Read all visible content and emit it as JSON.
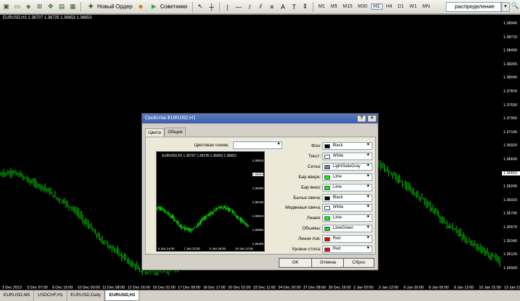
{
  "toolbar": {
    "new_order": "Новый Ордер",
    "advisors": "Советники",
    "timeframes": [
      "M1",
      "M5",
      "M15",
      "M30",
      "H1",
      "H4",
      "D1",
      "W1",
      "MN"
    ],
    "active_timeframe": "H1",
    "search_value": "распределение"
  },
  "chart": {
    "info": "EURUSD,H1  1.36707 1.36725 1.36653 1.36653",
    "price_labels": [
      "1.38940",
      "1.38715",
      "1.38490",
      "1.38265",
      "1.38040",
      "1.37815",
      "1.37590",
      "1.37365",
      "1.37145",
      "1.36920",
      "1.36695",
      "1.36653",
      "1.36245",
      "1.36020",
      "1.35795",
      "1.35570",
      "1.35345",
      "1.35125",
      "1.34900"
    ],
    "current_price": "1.36653",
    "time_labels": [
      "3 Dec 2013",
      "5 Dec 07:00",
      "6 Dec 15:00",
      "10 Dec 00:00",
      "11 Dec 08:00",
      "12 Dec 16:00",
      "16 Dec 01:00",
      "17 Dec 09:00",
      "18 Dec 17:00",
      "20 Dec 01:00",
      "23 Dec 11:00",
      "24 Dec 20:00",
      "27 Dec 08:00",
      "30 Dec 16:00",
      "2 Jan 02:00",
      "3 Jan 12:00",
      "6 Jan 20:00",
      "8 Jan 05:00",
      "9 Jan 13:00",
      "10 Jan 21:00",
      "13 Jan 19:00"
    ],
    "candle_color": "#00ff00",
    "background": "#000000"
  },
  "dialog": {
    "title": "Свойства EURUSD,H1",
    "help_btn": "?",
    "close_btn": "×",
    "tabs": [
      "Цвета",
      "Общие"
    ],
    "scheme_label": "Цветовая схема:",
    "scheme_value": "",
    "preview": {
      "info": "EURUSD,H1  1.36707 1.36725 1.36653 1.36653",
      "prices": [
        "1.36815",
        "1.36653",
        "1.36360",
        "1.36135",
        "1.35910",
        "1.35680",
        "1.35455"
      ],
      "times": [
        "6 Jan 14:00",
        "7 Jan 22:00",
        "9 Jan 06:00",
        "10 Jan 14:00"
      ]
    },
    "colors": [
      {
        "label": "Фон:",
        "value": "Black",
        "hex": "#000000"
      },
      {
        "label": "Текст:",
        "value": "White",
        "hex": "#ffffff"
      },
      {
        "label": "Сетка:",
        "value": "LightSlateGray",
        "hex": "#778899"
      },
      {
        "label": "Бар вверх:",
        "value": "Lime",
        "hex": "#00ff00"
      },
      {
        "label": "Бар вниз:",
        "value": "Lime",
        "hex": "#00ff00"
      },
      {
        "label": "Бычья свеча:",
        "value": "Black",
        "hex": "#000000"
      },
      {
        "label": "Медвежья свеча:",
        "value": "White",
        "hex": "#ffffff"
      },
      {
        "label": "Линия:",
        "value": "Lime",
        "hex": "#00ff00"
      },
      {
        "label": "Объемы:",
        "value": "LimeGreen",
        "hex": "#32cd32"
      },
      {
        "label": "Линия Ask:",
        "value": "Red",
        "hex": "#ff0000"
      },
      {
        "label": "Уровни стопа:",
        "value": "Red",
        "hex": "#ff0000"
      }
    ],
    "ok": "OK",
    "cancel": "Отмена",
    "reset": "Сброс"
  },
  "tabs": [
    "EURUSD,M5",
    "USDCHF,H1",
    "EURUSD,Daily",
    "EURUSD,H1"
  ],
  "active_tab": "EURUSD,H1"
}
